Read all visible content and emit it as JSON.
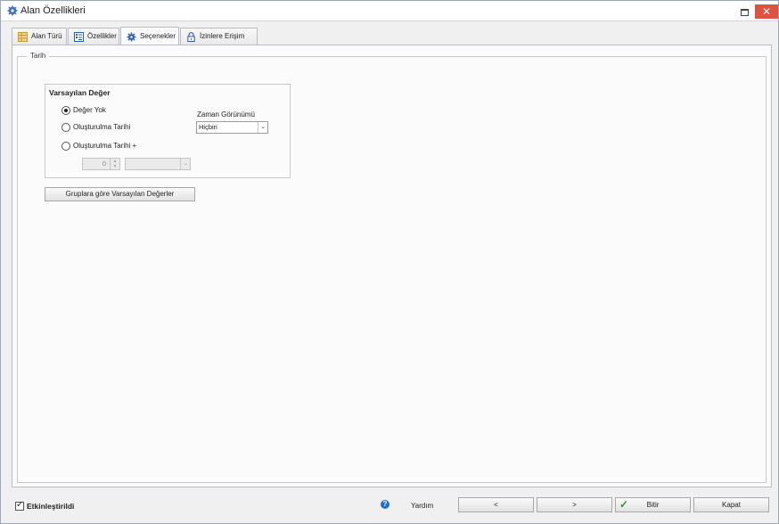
{
  "window": {
    "title": "Alan Özellikleri",
    "close_glyph": "✕"
  },
  "tabs": [
    {
      "label": "Alan Türü",
      "icon": "table-icon",
      "active": false
    },
    {
      "label": "Özellikler",
      "icon": "properties-list-icon",
      "active": false
    },
    {
      "label": "Seçenekler",
      "icon": "gear-icon",
      "active": true
    },
    {
      "label": "İzinlere Erişim",
      "icon": "lock-icon",
      "active": false
    }
  ],
  "main": {
    "group_label": "Tarih",
    "default_value": {
      "title": "Varsayılan Değer",
      "options": [
        {
          "label": "Değer Yok",
          "checked": true
        },
        {
          "label": "Oluşturulma Tarihi",
          "checked": false
        },
        {
          "label": "Oluşturulma Tarihi +",
          "checked": false
        }
      ],
      "offset_value": "0",
      "offset_unit": ""
    },
    "time_view": {
      "label": "Zaman Görünümü",
      "selected": "Hiçbiri"
    },
    "group_defaults_button": "Gruplara göre Varsayılan Değerler"
  },
  "footer": {
    "enabled_label": "Etkinleştirildi",
    "enabled_checked": true,
    "help_label": "Yardım",
    "prev_label": "<",
    "next_label": ">",
    "finish_label": "Bitir",
    "close_label": "Kapat"
  },
  "colors": {
    "accent_blue": "#1f6fd0",
    "close_red": "#e0523f",
    "finish_green": "#2f9a2f"
  }
}
